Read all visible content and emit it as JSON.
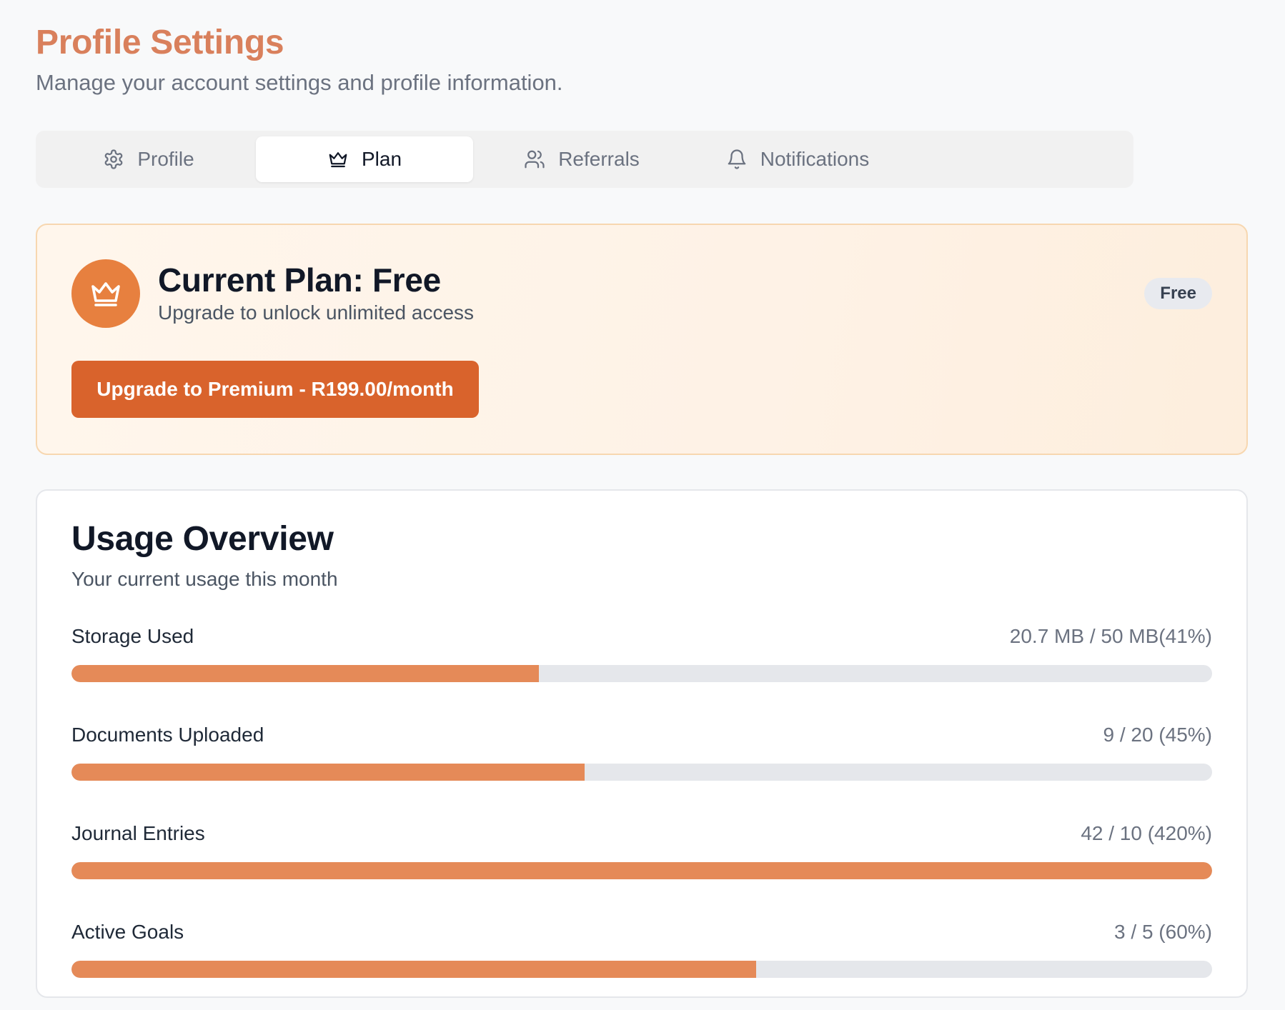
{
  "header": {
    "title": "Profile Settings",
    "subtitle": "Manage your account settings and profile information."
  },
  "tabs": [
    {
      "label": "Profile",
      "icon": "gear-icon",
      "active": false
    },
    {
      "label": "Plan",
      "icon": "crown-icon",
      "active": true
    },
    {
      "label": "Referrals",
      "icon": "users-icon",
      "active": false
    },
    {
      "label": "Notifications",
      "icon": "bell-icon",
      "active": false
    }
  ],
  "plan": {
    "icon": "crown-icon",
    "title": "Current Plan: Free",
    "description": "Upgrade to unlock unlimited access",
    "badge": "Free",
    "upgrade_label": "Upgrade to Premium - R199.00/month"
  },
  "usage": {
    "title": "Usage Overview",
    "subtitle": "Your current usage this month",
    "items": [
      {
        "label": "Storage Used",
        "value": "20.7 MB / 50 MB(41%)",
        "fill": 0.41
      },
      {
        "label": "Documents Uploaded",
        "value": "9 / 20 (45%)",
        "fill": 0.45
      },
      {
        "label": "Journal Entries",
        "value": "42 / 10 (420%)",
        "fill": 1.0
      },
      {
        "label": "Active Goals",
        "value": "3 / 5 (60%)",
        "fill": 0.6
      }
    ]
  },
  "colors": {
    "title": "#d9805c",
    "accent": "#e7803f",
    "button": "#d9632c",
    "progress_fill": "#e58a58",
    "progress_track": "#e5e7eb",
    "plan_card_border": "#f7d7b0"
  }
}
